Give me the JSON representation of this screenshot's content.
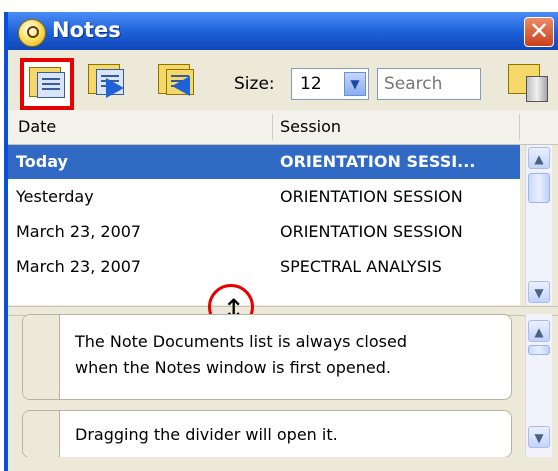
{
  "window": {
    "title": "Notes",
    "close_label": "✕"
  },
  "toolbar": {
    "size_label": "Size:",
    "size_value": "12",
    "search_placeholder": "Search"
  },
  "table": {
    "columns": [
      "Date",
      "Session"
    ],
    "rows": [
      {
        "date": "Today",
        "session": "ORIENTATION SESSI...",
        "selected": true
      },
      {
        "date": "Yesterday",
        "session": "ORIENTATION SESSION",
        "selected": false
      },
      {
        "date": "March 23, 2007",
        "session": "ORIENTATION SESSION",
        "selected": false
      },
      {
        "date": "March 23, 2007",
        "session": "SPECTRAL ANALYSIS",
        "selected": false
      }
    ]
  },
  "notes": [
    "The Note Documents list is always closed",
    "when the Notes window is first opened.",
    "Dragging the divider will open it."
  ],
  "icons": {
    "resize": "↕",
    "scroll_up": "▲",
    "scroll_down": "▼"
  }
}
